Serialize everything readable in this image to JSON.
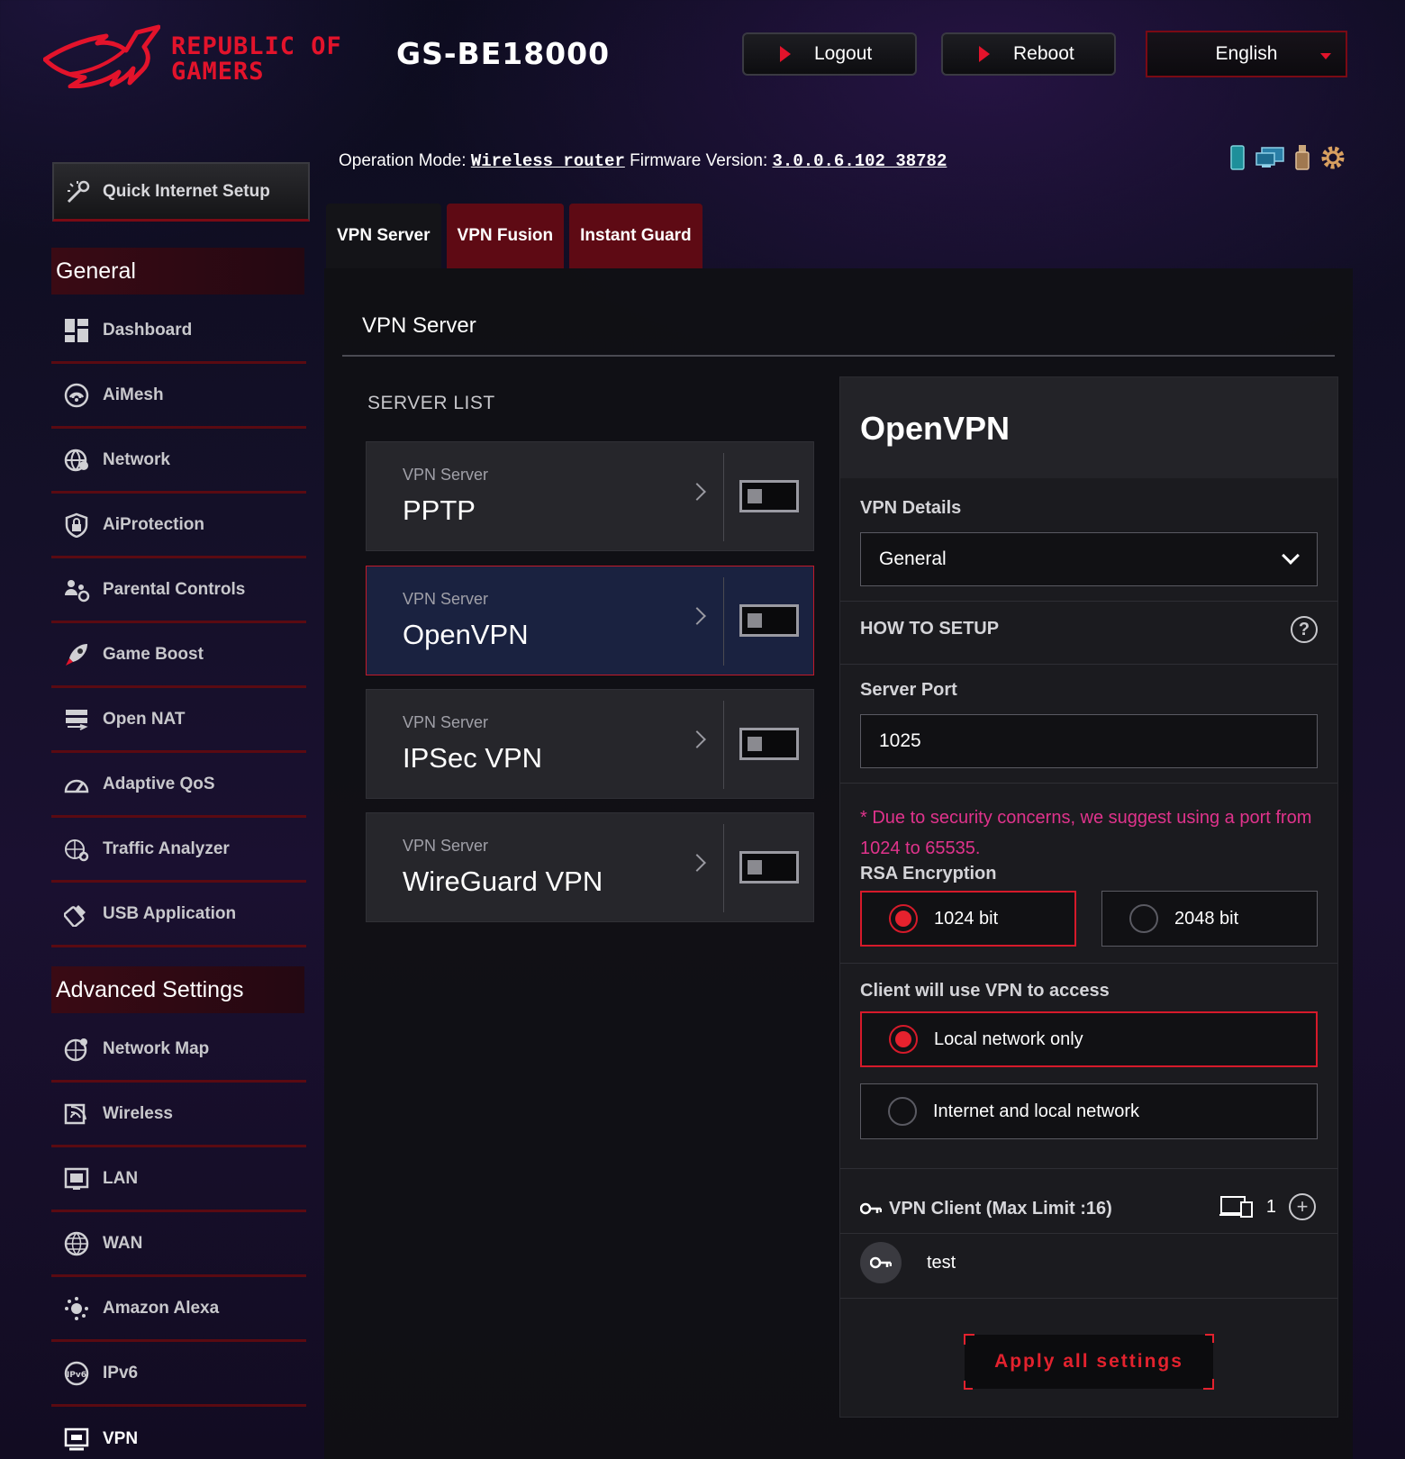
{
  "header": {
    "brand_line1": "REPUBLIC OF",
    "brand_line2": "GAMERS",
    "model": "GS-BE18000",
    "logout_label": "Logout",
    "reboot_label": "Reboot",
    "language": "English"
  },
  "status": {
    "op_mode_label": "Operation Mode:",
    "op_mode_value": "Wireless router",
    "firmware_label": "Firmware Version:",
    "firmware_value": "3.0.0.6.102_38782",
    "icons": [
      "phone-icon",
      "network-status-icon",
      "usb-icon",
      "settings-gear-icon"
    ]
  },
  "sidebar": {
    "quick_setup": "Quick Internet Setup",
    "general_title": "General",
    "general_items": [
      {
        "label": "Dashboard",
        "icon": "dashboard-icon"
      },
      {
        "label": "AiMesh",
        "icon": "aimesh-icon"
      },
      {
        "label": "Network",
        "icon": "network-icon"
      },
      {
        "label": "AiProtection",
        "icon": "aiprotection-icon"
      },
      {
        "label": "Parental Controls",
        "icon": "parental-controls-icon"
      },
      {
        "label": "Game Boost",
        "icon": "game-boost-icon"
      },
      {
        "label": "Open NAT",
        "icon": "open-nat-icon"
      },
      {
        "label": "Adaptive QoS",
        "icon": "adaptive-qos-icon"
      },
      {
        "label": "Traffic Analyzer",
        "icon": "traffic-analyzer-icon"
      },
      {
        "label": "USB Application",
        "icon": "usb-application-icon"
      }
    ],
    "advanced_title": "Advanced Settings",
    "advanced_items": [
      {
        "label": "Network Map",
        "icon": "network-map-icon"
      },
      {
        "label": "Wireless",
        "icon": "wireless-icon"
      },
      {
        "label": "LAN",
        "icon": "lan-icon"
      },
      {
        "label": "WAN",
        "icon": "wan-icon"
      },
      {
        "label": "Amazon Alexa",
        "icon": "alexa-icon"
      },
      {
        "label": "IPv6",
        "icon": "ipv6-icon"
      },
      {
        "label": "VPN",
        "icon": "vpn-icon"
      }
    ]
  },
  "tabs": [
    {
      "label": "VPN Server",
      "active": true
    },
    {
      "label": "VPN Fusion",
      "active": false
    },
    {
      "label": "Instant Guard",
      "active": false
    }
  ],
  "main": {
    "title": "VPN Server",
    "server_list_label": "SERVER LIST",
    "servers": [
      {
        "sub": "VPN Server",
        "name": "PPTP",
        "selected": false,
        "enabled": false
      },
      {
        "sub": "VPN Server",
        "name": "OpenVPN",
        "selected": true,
        "enabled": false
      },
      {
        "sub": "VPN Server",
        "name": "IPSec VPN",
        "selected": false,
        "enabled": false
      },
      {
        "sub": "VPN Server",
        "name": "WireGuard VPN",
        "selected": false,
        "enabled": false
      }
    ]
  },
  "details": {
    "title": "OpenVPN",
    "vpn_details_label": "VPN Details",
    "vpn_details_value": "General",
    "how_to_setup": "HOW TO SETUP",
    "server_port_label": "Server Port",
    "server_port_value": "1025",
    "port_note": "* Due to security concerns, we suggest using a port from 1024 to 65535.",
    "rsa_label": "RSA Encryption",
    "rsa_options": [
      "1024 bit",
      "2048 bit"
    ],
    "rsa_selected": "1024 bit",
    "access_label": "Client will use VPN to access",
    "access_options": [
      "Local network only",
      "Internet and local network"
    ],
    "access_selected": "Local network only",
    "client_label": "VPN Client (Max Limit :16)",
    "client_count": "1",
    "clients": [
      "test"
    ],
    "apply_label": "Apply all settings"
  },
  "colors": {
    "accent": "#e3132b",
    "warning_text": "#e0338c",
    "panel_bg": "#1b1b1f"
  }
}
